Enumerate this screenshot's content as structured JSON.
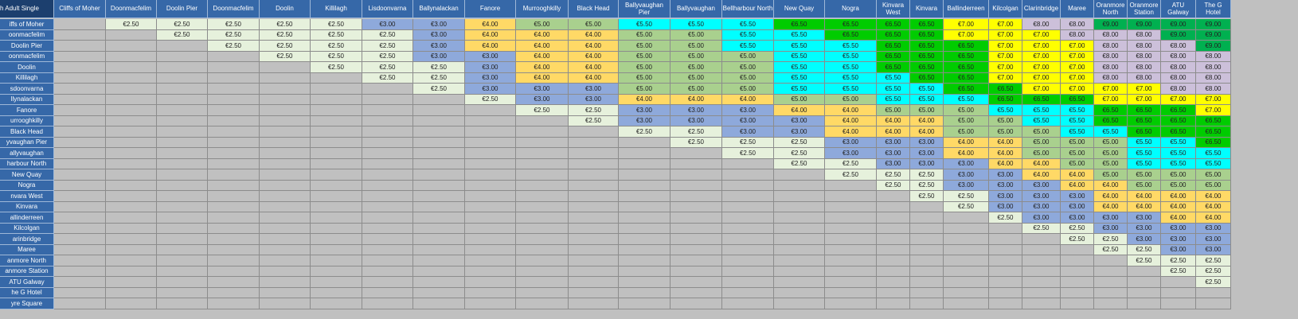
{
  "table": {
    "title": "h Adult Single",
    "columns": [
      "Cliffs of Moher",
      "Doonmacfelim",
      "Doolin Pier",
      "Doonmacfelim",
      "Doolin",
      "Killilagh",
      "Lisdoonvarna",
      "Ballynalackan",
      "Fanore",
      "Murrooghkilly",
      "Black Head",
      "Ballyvaughan Pier",
      "Ballyvaughan",
      "Bellharbour North",
      "New Quay",
      "Nogra",
      "Kinvara West",
      "Kinvara",
      "Ballinderreen",
      "Kilcolgan",
      "Clarinbridge",
      "Maree",
      "Oranmore North",
      "Oranmore Station",
      "ATU Galway",
      "The G Hotel"
    ],
    "rows": [
      {
        "label": "iffs of Moher",
        "fares": [
          "",
          "€2.50",
          "€2.50",
          "€2.50",
          "€2.50",
          "€2.50",
          "€3.00",
          "€3.00",
          "€4.00",
          "€5.00",
          "€5.00",
          "€5.50",
          "€5.50",
          "€5.50",
          "€6.50",
          "€6.50",
          "€6.50",
          "€6.50",
          "€7.00",
          "€7.00",
          "€8.00",
          "€8.00",
          "€9.00",
          "€9.00",
          "€9.00",
          "€9.00"
        ]
      },
      {
        "label": "oonmacfelim",
        "fares": [
          "",
          "",
          "€2.50",
          "€2.50",
          "€2.50",
          "€2.50",
          "€2.50",
          "€3.00",
          "€4.00",
          "€4.00",
          "€4.00",
          "€5.00",
          "€5.00",
          "€5.50",
          "€5.50",
          "€6.50",
          "€6.50",
          "€6.50",
          "€7.00",
          "€7.00",
          "€7.00",
          "€8.00",
          "€8.00",
          "€8.00",
          "€9.00",
          "€9.00"
        ]
      },
      {
        "label": "Doolin Pier",
        "fares": [
          "",
          "",
          "",
          "€2.50",
          "€2.50",
          "€2.50",
          "€2.50",
          "€3.00",
          "€4.00",
          "€4.00",
          "€4.00",
          "€5.00",
          "€5.00",
          "€5.50",
          "€5.50",
          "€5.50",
          "€6.50",
          "€6.50",
          "€6.50",
          "€7.00",
          "€7.00",
          "€7.00",
          "€8.00",
          "€8.00",
          "€8.00",
          "€9.00"
        ]
      },
      {
        "label": "oonmacfelim",
        "fares": [
          "",
          "",
          "",
          "",
          "€2.50",
          "€2.50",
          "€2.50",
          "€3.00",
          "€3.00",
          "€4.00",
          "€4.00",
          "€5.00",
          "€5.00",
          "€5.00",
          "€5.50",
          "€5.50",
          "€6.50",
          "€6.50",
          "€6.50",
          "€7.00",
          "€7.00",
          "€7.00",
          "€8.00",
          "€8.00",
          "€8.00",
          "€8.00"
        ]
      },
      {
        "label": "Doolin",
        "fares": [
          "",
          "",
          "",
          "",
          "",
          "€2.50",
          "€2.50",
          "€2.50",
          "€3.00",
          "€4.00",
          "€4.00",
          "€5.00",
          "€5.00",
          "€5.00",
          "€5.50",
          "€5.50",
          "€6.50",
          "€6.50",
          "€6.50",
          "€7.00",
          "€7.00",
          "€7.00",
          "€8.00",
          "€8.00",
          "€8.00",
          "€8.00"
        ]
      },
      {
        "label": "Killilagh",
        "fares": [
          "",
          "",
          "",
          "",
          "",
          "",
          "€2.50",
          "€2.50",
          "€3.00",
          "€4.00",
          "€4.00",
          "€5.00",
          "€5.00",
          "€5.00",
          "€5.50",
          "€5.50",
          "€5.50",
          "€6.50",
          "€6.50",
          "€7.00",
          "€7.00",
          "€7.00",
          "€8.00",
          "€8.00",
          "€8.00",
          "€8.00"
        ]
      },
      {
        "label": "sdoonvarna",
        "fares": [
          "",
          "",
          "",
          "",
          "",
          "",
          "",
          "€2.50",
          "€3.00",
          "€3.00",
          "€3.00",
          "€5.00",
          "€5.00",
          "€5.00",
          "€5.50",
          "€5.50",
          "€5.50",
          "€5.50",
          "€6.50",
          "€6.50",
          "€7.00",
          "€7.00",
          "€7.00",
          "€7.00",
          "€8.00",
          "€8.00"
        ]
      },
      {
        "label": "llynalackan",
        "fares": [
          "",
          "",
          "",
          "",
          "",
          "",
          "",
          "",
          "€2.50",
          "€3.00",
          "€3.00",
          "€4.00",
          "€4.00",
          "€4.00",
          "€5.00",
          "€5.00",
          "€5.50",
          "€5.50",
          "€5.50",
          "€6.50",
          "€6.50",
          "€6.50",
          "€7.00",
          "€7.00",
          "€7.00",
          "€7.00"
        ]
      },
      {
        "label": "Fanore",
        "fares": [
          "",
          "",
          "",
          "",
          "",
          "",
          "",
          "",
          "",
          "€2.50",
          "€2.50",
          "€3.00",
          "€3.00",
          "€3.00",
          "€4.00",
          "€4.00",
          "€5.00",
          "€5.00",
          "€5.00",
          "€5.50",
          "€5.50",
          "€5.50",
          "€6.50",
          "€6.50",
          "€6.50",
          "€7.00"
        ]
      },
      {
        "label": "urrooghkilly",
        "fares": [
          "",
          "",
          "",
          "",
          "",
          "",
          "",
          "",
          "",
          "",
          "€2.50",
          "€3.00",
          "€3.00",
          "€3.00",
          "€3.00",
          "€4.00",
          "€4.00",
          "€4.00",
          "€5.00",
          "€5.00",
          "€5.50",
          "€5.50",
          "€6.50",
          "€6.50",
          "€6.50",
          "€6.50"
        ]
      },
      {
        "label": "Black Head",
        "fares": [
          "",
          "",
          "",
          "",
          "",
          "",
          "",
          "",
          "",
          "",
          "",
          "€2.50",
          "€2.50",
          "€3.00",
          "€3.00",
          "€4.00",
          "€4.00",
          "€4.00",
          "€5.00",
          "€5.00",
          "€5.00",
          "€5.50",
          "€5.50",
          "€6.50",
          "€6.50",
          "€6.50"
        ]
      },
      {
        "label": "yvaughan Pier",
        "fares": [
          "",
          "",
          "",
          "",
          "",
          "",
          "",
          "",
          "",
          "",
          "",
          "",
          "€2.50",
          "€2.50",
          "€2.50",
          "€3.00",
          "€3.00",
          "€3.00",
          "€4.00",
          "€4.00",
          "€5.00",
          "€5.00",
          "€5.00",
          "€5.50",
          "€5.50",
          "€6.50"
        ]
      },
      {
        "label": "allyvaughan",
        "fares": [
          "",
          "",
          "",
          "",
          "",
          "",
          "",
          "",
          "",
          "",
          "",
          "",
          "",
          "€2.50",
          "€2.50",
          "€3.00",
          "€3.00",
          "€3.00",
          "€4.00",
          "€4.00",
          "€5.00",
          "€5.00",
          "€5.00",
          "€5.50",
          "€5.50",
          "€5.50"
        ]
      },
      {
        "label": "harbour North",
        "fares": [
          "",
          "",
          "",
          "",
          "",
          "",
          "",
          "",
          "",
          "",
          "",
          "",
          "",
          "",
          "€2.50",
          "€2.50",
          "€3.00",
          "€3.00",
          "€3.00",
          "€4.00",
          "€4.00",
          "€5.00",
          "€5.00",
          "€5.50",
          "€5.50",
          "€5.50"
        ]
      },
      {
        "label": "New Quay",
        "fares": [
          "",
          "",
          "",
          "",
          "",
          "",
          "",
          "",
          "",
          "",
          "",
          "",
          "",
          "",
          "",
          "€2.50",
          "€2.50",
          "€2.50",
          "€3.00",
          "€3.00",
          "€4.00",
          "€4.00",
          "€5.00",
          "€5.00",
          "€5.00",
          "€5.00"
        ]
      },
      {
        "label": "Nogra",
        "fares": [
          "",
          "",
          "",
          "",
          "",
          "",
          "",
          "",
          "",
          "",
          "",
          "",
          "",
          "",
          "",
          "",
          "€2.50",
          "€2.50",
          "€3.00",
          "€3.00",
          "€3.00",
          "€4.00",
          "€4.00",
          "€5.00",
          "€5.00",
          "€5.00"
        ]
      },
      {
        "label": "nvara West",
        "fares": [
          "",
          "",
          "",
          "",
          "",
          "",
          "",
          "",
          "",
          "",
          "",
          "",
          "",
          "",
          "",
          "",
          "",
          "€2.50",
          "€2.50",
          "€3.00",
          "€3.00",
          "€3.00",
          "€4.00",
          "€4.00",
          "€4.00",
          "€4.00"
        ]
      },
      {
        "label": "Kinvara",
        "fares": [
          "",
          "",
          "",
          "",
          "",
          "",
          "",
          "",
          "",
          "",
          "",
          "",
          "",
          "",
          "",
          "",
          "",
          "",
          "€2.50",
          "€3.00",
          "€3.00",
          "€3.00",
          "€4.00",
          "€4.00",
          "€4.00",
          "€4.00"
        ]
      },
      {
        "label": "allinderreen",
        "fares": [
          "",
          "",
          "",
          "",
          "",
          "",
          "",
          "",
          "",
          "",
          "",
          "",
          "",
          "",
          "",
          "",
          "",
          "",
          "",
          "€2.50",
          "€3.00",
          "€3.00",
          "€3.00",
          "€3.00",
          "€4.00",
          "€4.00"
        ]
      },
      {
        "label": "Kilcolgan",
        "fares": [
          "",
          "",
          "",
          "",
          "",
          "",
          "",
          "",
          "",
          "",
          "",
          "",
          "",
          "",
          "",
          "",
          "",
          "",
          "",
          "",
          "€2.50",
          "€2.50",
          "€3.00",
          "€3.00",
          "€3.00",
          "€3.00"
        ]
      },
      {
        "label": "arinbridge",
        "fares": [
          "",
          "",
          "",
          "",
          "",
          "",
          "",
          "",
          "",
          "",
          "",
          "",
          "",
          "",
          "",
          "",
          "",
          "",
          "",
          "",
          "",
          "€2.50",
          "€2.50",
          "€3.00",
          "€3.00",
          "€3.00"
        ]
      },
      {
        "label": "Maree",
        "fares": [
          "",
          "",
          "",
          "",
          "",
          "",
          "",
          "",
          "",
          "",
          "",
          "",
          "",
          "",
          "",
          "",
          "",
          "",
          "",
          "",
          "",
          "",
          "€2.50",
          "€2.50",
          "€3.00",
          "€3.00"
        ]
      },
      {
        "label": "anmore North",
        "fares": [
          "",
          "",
          "",
          "",
          "",
          "",
          "",
          "",
          "",
          "",
          "",
          "",
          "",
          "",
          "",
          "",
          "",
          "",
          "",
          "",
          "",
          "",
          "",
          "€2.50",
          "€2.50",
          "€2.50"
        ]
      },
      {
        "label": "anmore Station",
        "fares": [
          "",
          "",
          "",
          "",
          "",
          "",
          "",
          "",
          "",
          "",
          "",
          "",
          "",
          "",
          "",
          "",
          "",
          "",
          "",
          "",
          "",
          "",
          "",
          "",
          "€2.50",
          "€2.50"
        ]
      },
      {
        "label": "ATU Galway",
        "fares": [
          "",
          "",
          "",
          "",
          "",
          "",
          "",
          "",
          "",
          "",
          "",
          "",
          "",
          "",
          "",
          "",
          "",
          "",
          "",
          "",
          "",
          "",
          "",
          "",
          "",
          "€2.50"
        ]
      },
      {
        "label": "he G Hotel",
        "fares": [
          "",
          "",
          "",
          "",
          "",
          "",
          "",
          "",
          "",
          "",
          "",
          "",
          "",
          "",
          "",
          "",
          "",
          "",
          "",
          "",
          "",
          "",
          "",
          "",
          "",
          ""
        ]
      },
      {
        "label": "yre Square",
        "fares": [
          "",
          "",
          "",
          "",
          "",
          "",
          "",
          "",
          "",
          "",
          "",
          "",
          "",
          "",
          "",
          "",
          "",
          "",
          "",
          "",
          "",
          "",
          "",
          "",
          "",
          ""
        ]
      }
    ]
  },
  "fare_colors": {
    "€2.50": "#e6f1dc",
    "€3.00": "#8ea9db",
    "€4.00": "#ffd966",
    "€5.00": "#a9d08e",
    "€5.50": "#00ffff",
    "€6.50": "#00cc00",
    "€7.00": "#ffff00",
    "€8.00": "#ccc0da",
    "€9.00": "#00b050"
  }
}
